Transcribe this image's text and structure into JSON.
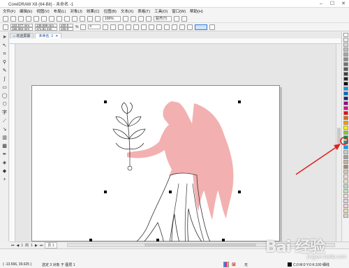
{
  "app": {
    "title": "CorelDRAW X8 (64-Bit) - 未命名 -1"
  },
  "menu": [
    "文件(F)",
    "编辑(E)",
    "视图(V)",
    "布局(L)",
    "对象(J)",
    "效果(C)",
    "位图(B)",
    "文本(X)",
    "表格(T)",
    "工具(O)",
    "窗口(W)",
    "帮助(H)"
  ],
  "toolbar": {
    "zoom": "100%",
    "snap": "贴齐(T)"
  },
  "property_bar": {
    "x": "102.077 mm",
    "y": "155.353 mm",
    "w": "139.599 mm",
    "h": "171.81 mm",
    "scale_w": "100.0",
    "scale_h": "100.0",
    "pct": "%",
    "rotation": "0"
  },
  "tabs": [
    "欢迎屏幕",
    "未命名 -1"
  ],
  "page_nav": {
    "current": "1",
    "of": "的",
    "total": "1",
    "page_label": "页 1"
  },
  "status": {
    "coords": "( -13.566, 39.625 )",
    "selection": "选定 3 对象 于 图层 1",
    "outline": "无",
    "fill": "C:0 M:0 Y:0 K:100 细线"
  },
  "watermark": {
    "brand": "Bai 经验",
    "site": "jingyan.baidu.com"
  },
  "colors": {
    "figure_fill": "#f2b1b0",
    "arrow": "#e02020",
    "accent": "#1a4fa0"
  },
  "palette": [
    "#ffffff",
    "#f0f0f0",
    "#d9d9d9",
    "#bfbfbf",
    "#a6a6a6",
    "#8c8c8c",
    "#737373",
    "#595959",
    "#404040",
    "#262626",
    "#000000",
    "#00a0e9",
    "#0068b7",
    "#1d2088",
    "#920783",
    "#e4007f",
    "#e60012",
    "#eb6100",
    "#f39800",
    "#fff100",
    "#8fc31f",
    "#009944",
    "#009e96",
    "#00a0e9",
    "#c9caca",
    "#9fa0a0",
    "#c7b299",
    "#a88a6a",
    "#d5c9b4",
    "#e5e0d4",
    "#eae0c8",
    "#b4d7e5",
    "#c3e0b7",
    "#f5dbd7",
    "#ddd1e9",
    "#f7d0d5",
    "#fbd7a4",
    "#d4d4d4"
  ]
}
